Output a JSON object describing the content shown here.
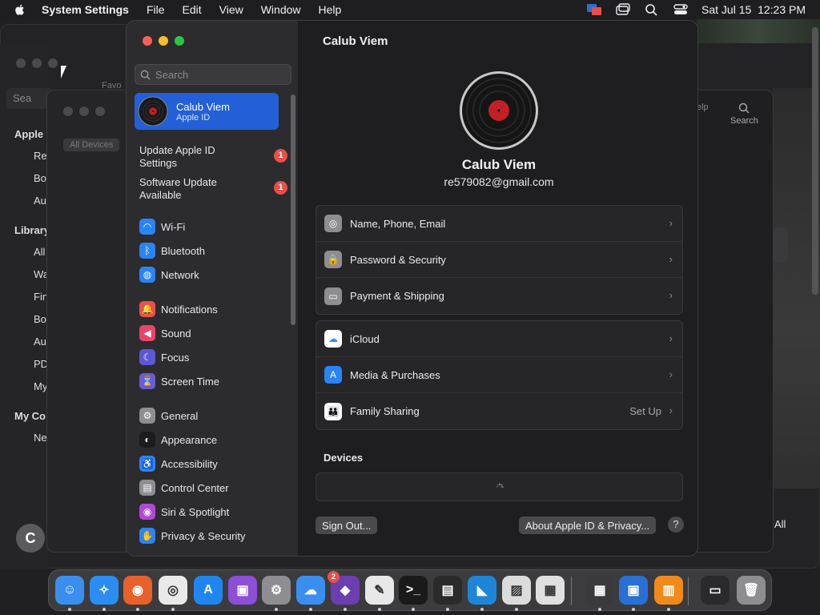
{
  "menubar": {
    "app_name": "System Settings",
    "menus": [
      "File",
      "Edit",
      "View",
      "Window",
      "Help"
    ],
    "clock": "Sat Jul 15  12:23 PM"
  },
  "background": {
    "favorites_label": "Favo",
    "search_label": "Sea",
    "section_apple": "Apple",
    "section_library": "Library",
    "section_my": "My Co",
    "items": [
      "Re",
      "Bo",
      "Au",
      "All",
      "Wa",
      "Fin",
      "Bo",
      "Au",
      "PD",
      "My",
      "Ne"
    ],
    "all_devices": "All Devices",
    "help_label": "elp",
    "search_right": "Search",
    "all_label": "All",
    "avatar_letter": "C"
  },
  "sidebar": {
    "search_placeholder": "Search",
    "apple_id": {
      "name": "Calub Viem",
      "sub": "Apple ID"
    },
    "notices": [
      {
        "label": "Update Apple ID Settings",
        "badge": "1"
      },
      {
        "label": "Software Update Available",
        "badge": "1"
      }
    ],
    "groups": [
      [
        {
          "label": "Wi-Fi",
          "icon": "wifi-icon",
          "color": "#2a84f6",
          "glyph": "◠"
        },
        {
          "label": "Bluetooth",
          "icon": "bluetooth-icon",
          "color": "#2a84f6",
          "glyph": "ᛒ"
        },
        {
          "label": "Network",
          "icon": "globe-icon",
          "color": "#2a84f6",
          "glyph": "◍"
        }
      ],
      [
        {
          "label": "Notifications",
          "icon": "bell-icon",
          "color": "#e9504b",
          "glyph": "🔔"
        },
        {
          "label": "Sound",
          "icon": "speaker-icon",
          "color": "#e9456b",
          "glyph": "◀"
        },
        {
          "label": "Focus",
          "icon": "moon-icon",
          "color": "#5c58d6",
          "glyph": "☾"
        },
        {
          "label": "Screen Time",
          "icon": "hourglass-icon",
          "color": "#6b5bd6",
          "glyph": "⌛"
        }
      ],
      [
        {
          "label": "General",
          "icon": "gear-icon",
          "color": "#8d8d92",
          "glyph": "⚙"
        },
        {
          "label": "Appearance",
          "icon": "appearance-icon",
          "color": "#1c1c1e",
          "glyph": "◐"
        },
        {
          "label": "Accessibility",
          "icon": "accessibility-icon",
          "color": "#2a84f6",
          "glyph": "♿"
        },
        {
          "label": "Control Center",
          "icon": "control-center-icon",
          "color": "#8d8d92",
          "glyph": "▤"
        },
        {
          "label": "Siri & Spotlight",
          "icon": "siri-icon",
          "color": "#b347d6",
          "glyph": "◉"
        },
        {
          "label": "Privacy & Security",
          "icon": "hand-icon",
          "color": "#2a84f6",
          "glyph": "✋"
        }
      ]
    ]
  },
  "main": {
    "title": "Calub Viem",
    "profile_name": "Calub Viem",
    "email": "re579082@gmail.com",
    "group1": [
      {
        "label": "Name, Phone, Email",
        "icon": "person-icon",
        "color": "#8d8d92",
        "glyph": "◎"
      },
      {
        "label": "Password & Security",
        "icon": "lock-icon",
        "color": "#8d8d92",
        "glyph": "🔒"
      },
      {
        "label": "Payment & Shipping",
        "icon": "card-icon",
        "color": "#8d8d92",
        "glyph": "▭"
      }
    ],
    "group2": [
      {
        "label": "iCloud",
        "icon": "icloud-icon",
        "color": "#ffffff",
        "glyph": "☁",
        "value": ""
      },
      {
        "label": "Media & Purchases",
        "icon": "app-store-icon",
        "color": "#2a84f6",
        "glyph": "A",
        "value": ""
      },
      {
        "label": "Family Sharing",
        "icon": "family-icon",
        "color": "#ffffff",
        "glyph": "👪",
        "value": "Set Up"
      }
    ],
    "devices_label": "Devices",
    "sign_out": "Sign Out...",
    "about": "About Apple ID & Privacy...",
    "help": "?"
  },
  "dock": {
    "settings_badge": "2",
    "icons": [
      {
        "name": "finder-icon",
        "color": "#3a8ef0",
        "glyph": "☺"
      },
      {
        "name": "safari-icon",
        "color": "#2b8cf2",
        "glyph": "✧"
      },
      {
        "name": "firefox-icon",
        "color": "#e8602c",
        "glyph": "◉"
      },
      {
        "name": "chrome-icon",
        "color": "#e9e9e9",
        "glyph": "◎"
      },
      {
        "name": "app-store-icon",
        "color": "#1f86f0",
        "glyph": "A"
      },
      {
        "name": "podcasts-icon",
        "color": "#8c4fd6",
        "glyph": "▣"
      },
      {
        "name": "system-settings-icon",
        "color": "#8d8d92",
        "glyph": "⚙"
      },
      {
        "name": "weather-icon",
        "color": "#3a8ef0",
        "glyph": "☁"
      },
      {
        "name": "visual-studio-icon",
        "color": "#6b3fb0",
        "glyph": "◆"
      },
      {
        "name": "textedit-icon",
        "color": "#e8e8e8",
        "glyph": "✎"
      },
      {
        "name": "terminal-icon",
        "color": "#1a1a1a",
        "glyph": ">_"
      },
      {
        "name": "console-icon",
        "color": "#2a2a2a",
        "glyph": "▤"
      },
      {
        "name": "vscode-icon",
        "color": "#1e86d8",
        "glyph": "◣"
      },
      {
        "name": "preview-icon",
        "color": "#dcdcdc",
        "glyph": "▨"
      },
      {
        "name": "launchpad-icon",
        "color": "#e0e0e0",
        "glyph": "▦"
      },
      {
        "name": "calculator-icon",
        "color": "#3a3a3c",
        "glyph": "▦"
      },
      {
        "name": "screen-sharing-icon",
        "color": "#2a6fd6",
        "glyph": "▣"
      },
      {
        "name": "books-icon",
        "color": "#f08a1c",
        "glyph": "▥"
      },
      {
        "name": "downloads-folder-icon",
        "color": "#2a2a2c",
        "glyph": "▭"
      },
      {
        "name": "trash-icon",
        "color": "#8d8d92",
        "glyph": "🗑"
      }
    ]
  }
}
